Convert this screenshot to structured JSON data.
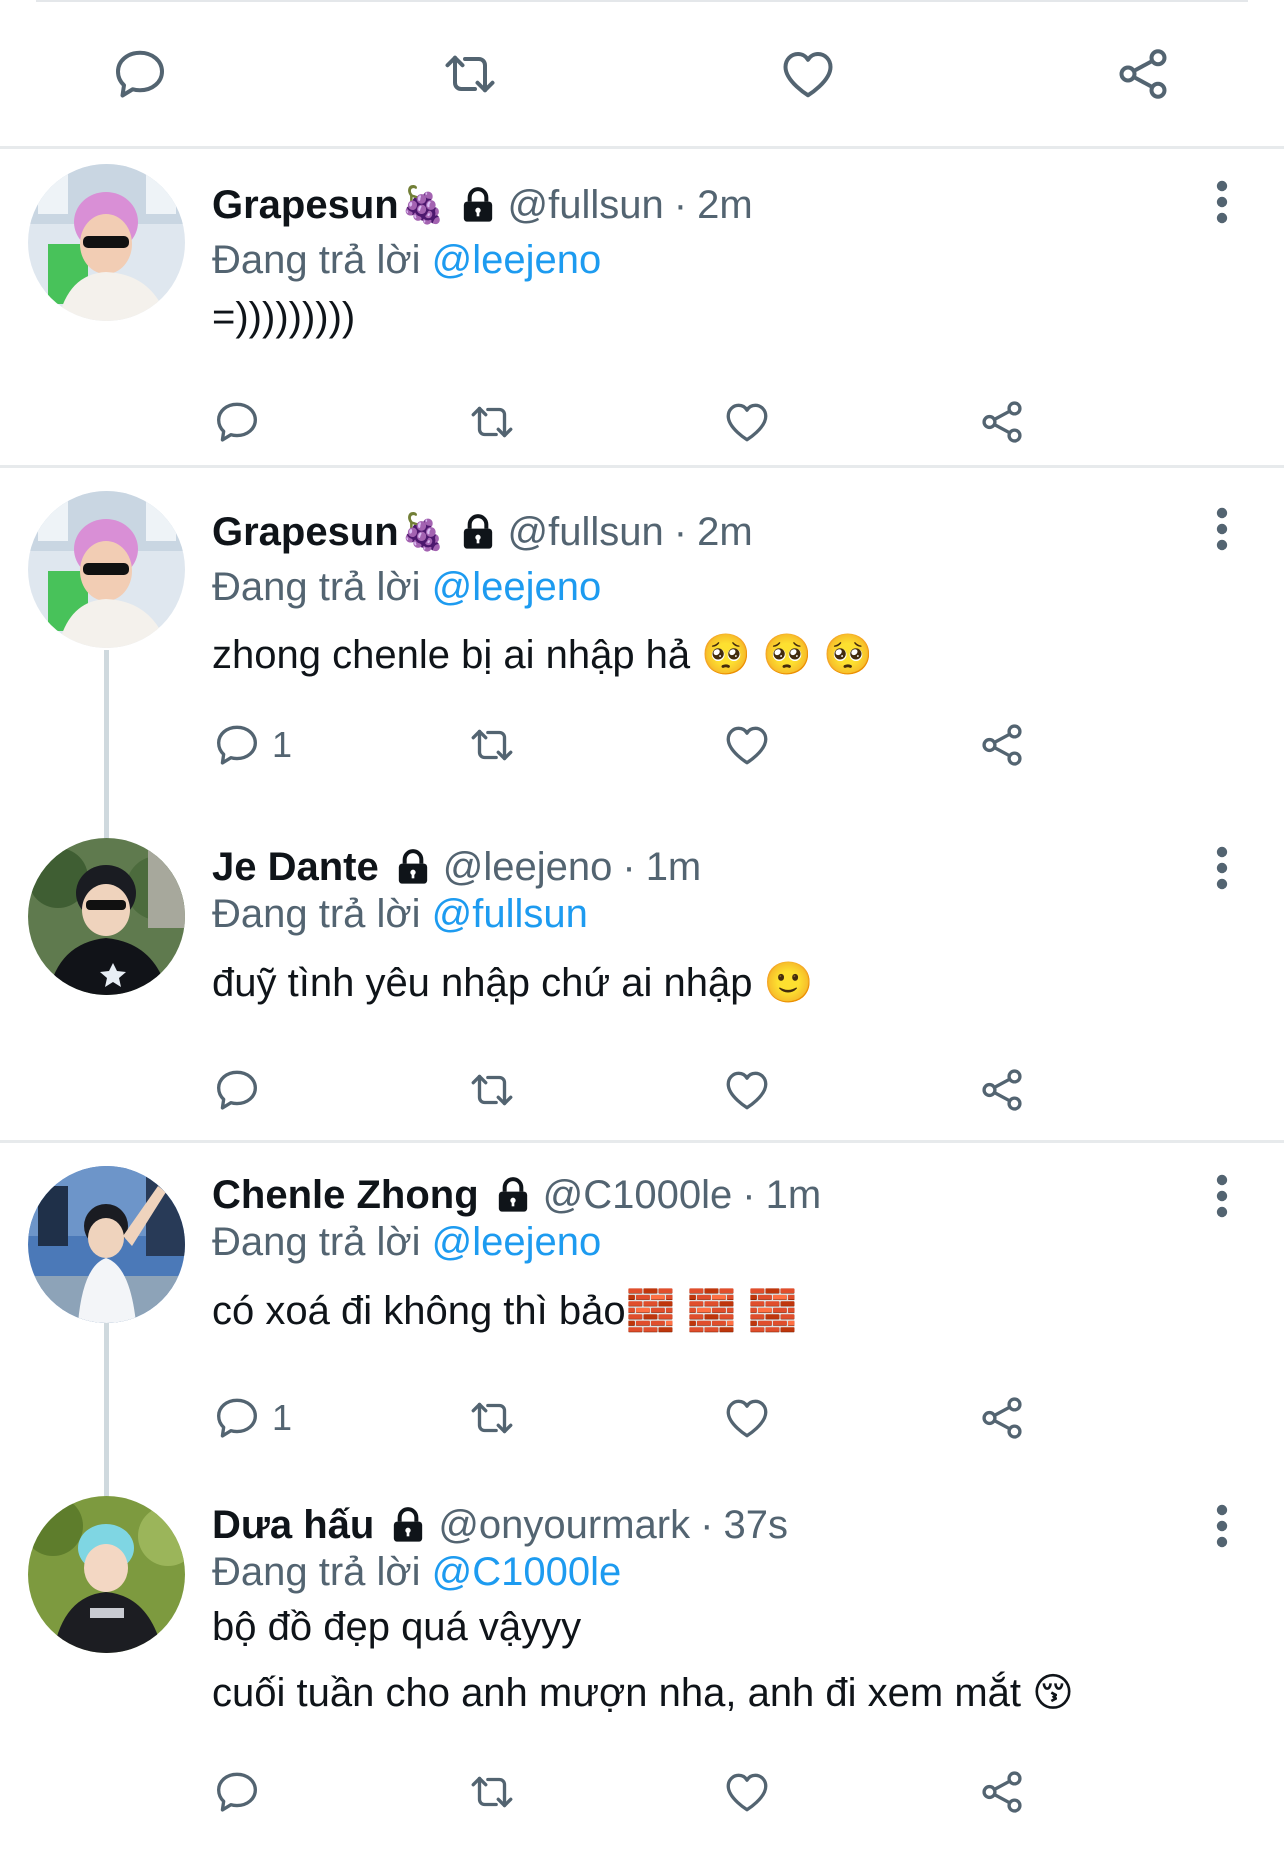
{
  "top_actions": [
    "reply-icon",
    "retweet-icon",
    "like-icon",
    "share-icon"
  ],
  "colors": {
    "accent": "#1d9bf0",
    "muted": "#536471",
    "text": "#0f1419",
    "divider": "#e7eaec"
  },
  "tweets": [
    {
      "name": "Grapesun",
      "name_emoji": "🍇",
      "handle": "@fullsun",
      "separator": "·",
      "time": "2m",
      "reply_prefix": "Đang trả lời",
      "reply_to": "@leejeno",
      "lines": [
        "=)))))))))"
      ],
      "reply_count": ""
    },
    {
      "name": "Grapesun",
      "name_emoji": "🍇",
      "handle": "@fullsun",
      "separator": "·",
      "time": "2m",
      "reply_prefix": "Đang trả lời",
      "reply_to": "@leejeno",
      "lines": [
        "zhong chenle bị ai nhập hả 🥺 🥺 🥺"
      ],
      "reply_count": "1"
    },
    {
      "name": "Je Dante",
      "name_emoji": "",
      "handle": "@leejeno",
      "separator": "·",
      "time": "1m",
      "reply_prefix": "Đang trả lời",
      "reply_to": "@fullsun",
      "lines": [
        "đuỹ tình yêu nhập chứ ai nhập 🙂"
      ],
      "reply_count": ""
    },
    {
      "name": "Chenle Zhong",
      "name_emoji": "",
      "handle": "@C1000le",
      "separator": "·",
      "time": "1m",
      "reply_prefix": "Đang trả lời",
      "reply_to": "@leejeno",
      "lines": [
        "có xoá đi không thì bảo🧱 🧱 🧱"
      ],
      "reply_count": "1"
    },
    {
      "name": "Dưa hấu",
      "name_emoji": "",
      "handle": "@onyourmark",
      "separator": "·",
      "time": "37s",
      "reply_prefix": "Đang trả lời",
      "reply_to": "@C1000le",
      "lines": [
        "bộ đồ đẹp quá vậyyy",
        "cuối tuần cho anh mượn nha, anh đi xem mắt 😚"
      ],
      "reply_count": ""
    }
  ]
}
